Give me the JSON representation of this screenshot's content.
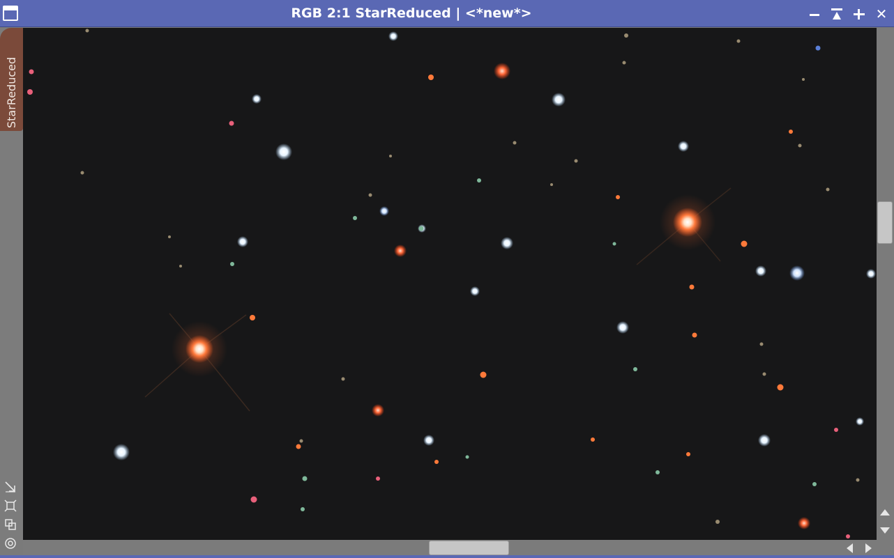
{
  "window": {
    "title": "RGB 2:1 StarReduced | <*new*>",
    "titlebar_color": "#5a68b4",
    "buttons": [
      "minimize-icon",
      "shade-icon",
      "maximize-icon",
      "close-icon"
    ],
    "close_glyph": "✕"
  },
  "view_tab": {
    "label": "StarReduced",
    "color": "#7b4a3a"
  },
  "left_strip_icons": [
    "fit-view-icon",
    "zoom-to-fit-icon",
    "clone-view-icon",
    "target-icon"
  ],
  "image": {
    "background_color": "#171718",
    "description_icon": "star-field-image"
  },
  "scrollbars": {
    "vertical": [
      "scroll-up-icon",
      "scroll-down-icon"
    ],
    "horizontal": [
      "scroll-left-icon",
      "scroll-right-icon"
    ]
  }
}
